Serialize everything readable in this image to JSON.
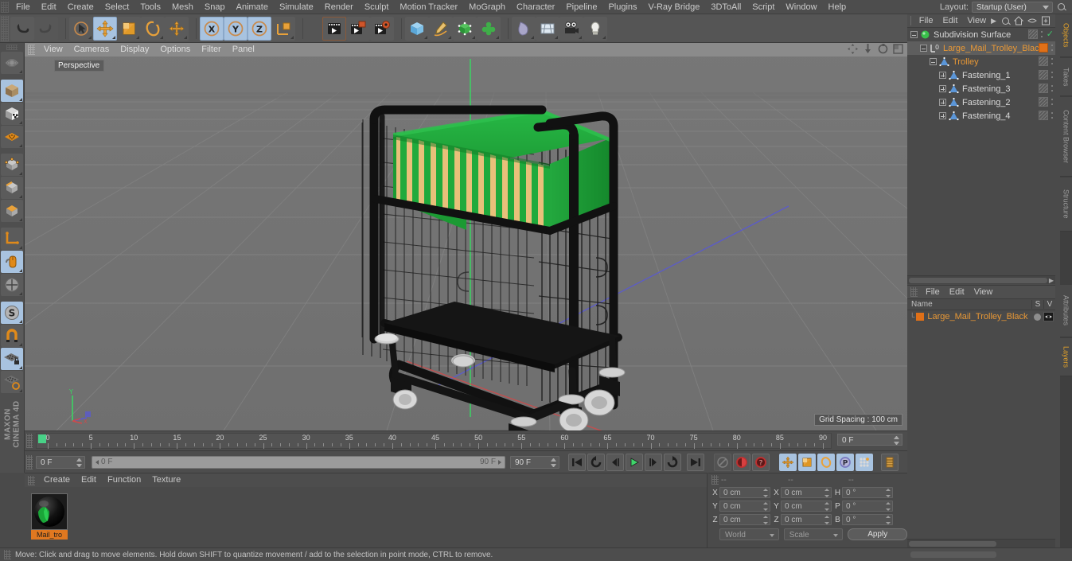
{
  "app": {
    "name": "MAXON CINEMA 4D",
    "brand_line1": "MAXON",
    "brand_line2": "CINEMA 4D"
  },
  "menubar": {
    "items": [
      {
        "label": "File"
      },
      {
        "label": "Edit"
      },
      {
        "label": "Create"
      },
      {
        "label": "Select"
      },
      {
        "label": "Tools"
      },
      {
        "label": "Mesh"
      },
      {
        "label": "Snap"
      },
      {
        "label": "Animate"
      },
      {
        "label": "Simulate"
      },
      {
        "label": "Render"
      },
      {
        "label": "Sculpt"
      },
      {
        "label": "Motion Tracker"
      },
      {
        "label": "MoGraph"
      },
      {
        "label": "Character"
      },
      {
        "label": "Pipeline"
      },
      {
        "label": "Plugins"
      },
      {
        "label": "V-Ray Bridge"
      },
      {
        "label": "3DToAll"
      },
      {
        "label": "Script"
      },
      {
        "label": "Window"
      },
      {
        "label": "Help"
      }
    ],
    "layout_label": "Layout:",
    "layout_value": "Startup (User)",
    "search_icon": "search-icon"
  },
  "toolbar": {
    "items": [
      {
        "name": "undo-button",
        "icon": "undo-arrow-icon",
        "active": false
      },
      {
        "name": "redo-button",
        "icon": "redo-arrow-icon",
        "active": false
      },
      {
        "name": "live-selection-tool",
        "icon": "cursor-circle-icon",
        "active": false
      },
      {
        "name": "move-tool",
        "icon": "move-arrows-icon",
        "active": true
      },
      {
        "name": "scale-tool",
        "icon": "scale-box-icon",
        "active": false
      },
      {
        "name": "rotate-tool",
        "icon": "rotate-ring-icon",
        "active": false
      },
      {
        "name": "axis-tool",
        "icon": "plus-axis-icon",
        "active": false
      },
      {
        "name": "x-axis-lock",
        "icon": "x-axis-icon",
        "active": true
      },
      {
        "name": "y-axis-lock",
        "icon": "y-axis-icon",
        "active": true
      },
      {
        "name": "z-axis-lock",
        "icon": "z-axis-icon",
        "active": true
      },
      {
        "name": "world-object-coordinate-toggle",
        "icon": "world-axis-cube-icon",
        "active": false
      },
      {
        "name": "render-view-button",
        "icon": "render-clapper-icon",
        "active": false
      },
      {
        "name": "render-region-button",
        "icon": "render-region-icon",
        "active": false
      },
      {
        "name": "render-settings-button",
        "icon": "render-settings-gear-icon",
        "active": false
      },
      {
        "name": "primitive-cube-menu",
        "icon": "cube-icon",
        "active": false
      },
      {
        "name": "spline-pen-menu",
        "icon": "pen-spline-icon",
        "active": false
      },
      {
        "name": "generator-menu",
        "icon": "green-cube-generator-icon",
        "active": false
      },
      {
        "name": "modeling-object-menu",
        "icon": "green-cluster-icon",
        "active": false
      },
      {
        "name": "deformer-menu",
        "icon": "bend-deformer-icon",
        "active": false
      },
      {
        "name": "scene-environment-menu",
        "icon": "floor-grid-icon",
        "active": false
      },
      {
        "name": "camera-menu",
        "icon": "camera-icon",
        "active": false
      },
      {
        "name": "light-menu",
        "icon": "light-bulb-icon",
        "active": false
      }
    ]
  },
  "left_toolbar": {
    "items": [
      {
        "name": "make-editable-button",
        "icon": "make-editable-icon",
        "active": false
      },
      {
        "name": "model-mode-button",
        "icon": "model-cube-icon",
        "active": true
      },
      {
        "name": "texture-mode-button",
        "icon": "texture-cube-icon",
        "active": false
      },
      {
        "name": "texture-axis-button",
        "icon": "texture-axis-icon",
        "active": false
      },
      {
        "name": "point-mode-button",
        "icon": "point-cube-icon",
        "active": false
      },
      {
        "name": "edge-mode-button",
        "icon": "edge-cube-icon",
        "active": false
      },
      {
        "name": "polygon-mode-button",
        "icon": "polygon-cube-icon",
        "active": false
      },
      {
        "name": "object-axis-button",
        "icon": "object-axis-icon",
        "active": false
      },
      {
        "name": "viewport-solo-button",
        "icon": "mouse-icon",
        "active": true
      },
      {
        "name": "enable-axis-button",
        "icon": "axis-modify-icon",
        "active": false
      },
      {
        "name": "soft-selection-button",
        "icon": "soft-selection-s-icon",
        "active": true
      },
      {
        "name": "snap-button",
        "icon": "magnet-icon",
        "active": false
      },
      {
        "name": "workplane-lock-button",
        "icon": "workplane-lock-icon",
        "active": true
      },
      {
        "name": "workplane-button",
        "icon": "workplane-icon",
        "active": false
      }
    ]
  },
  "viewport": {
    "menu_items": [
      {
        "label": "View"
      },
      {
        "label": "Cameras"
      },
      {
        "label": "Display"
      },
      {
        "label": "Options"
      },
      {
        "label": "Filter"
      },
      {
        "label": "Panel"
      }
    ],
    "label": "Perspective",
    "grid_spacing": "Grid Spacing : 100 cm",
    "corner_icons": [
      {
        "name": "viewport-pan-icon"
      },
      {
        "name": "viewport-dolly-icon"
      },
      {
        "name": "viewport-orbit-icon"
      },
      {
        "name": "viewport-maximize-icon"
      }
    ],
    "axis_gizmo": {
      "y_label": "Y",
      "x_label": "X",
      "z_label": "Z"
    },
    "scene": {
      "object": "Large Mail Trolley (Black)",
      "frame_color": "#1b1b1b",
      "folder_green": "#1faa3c",
      "envelope_tan": "#e8c07a",
      "wheel_color": "#cfcfcf",
      "ground_color": "#737373"
    }
  },
  "timeline": {
    "ticks": [
      {
        "label": "0",
        "value": 0
      },
      {
        "label": "5",
        "value": 5
      },
      {
        "label": "10",
        "value": 10
      },
      {
        "label": "15",
        "value": 15
      },
      {
        "label": "20",
        "value": 20
      },
      {
        "label": "25",
        "value": 25
      },
      {
        "label": "30",
        "value": 30
      },
      {
        "label": "35",
        "value": 35
      },
      {
        "label": "40",
        "value": 40
      },
      {
        "label": "45",
        "value": 45
      },
      {
        "label": "50",
        "value": 50
      },
      {
        "label": "55",
        "value": 55
      },
      {
        "label": "60",
        "value": 60
      },
      {
        "label": "65",
        "value": 65
      },
      {
        "label": "70",
        "value": 70
      },
      {
        "label": "75",
        "value": 75
      },
      {
        "label": "80",
        "value": 80
      },
      {
        "label": "85",
        "value": 85
      },
      {
        "label": "90",
        "value": 90
      }
    ],
    "current_frame_field": "0 F",
    "range_min": 0,
    "range_max": 90,
    "playhead_frame": 0
  },
  "playbar": {
    "current_frame": "0 F",
    "range_start": "0 F",
    "range_end_inline": "90 F",
    "range_end": "90 F",
    "buttons": [
      {
        "name": "go-to-start-button",
        "icon": "skip-start-icon",
        "active": false
      },
      {
        "name": "play-backwards-loop-button",
        "icon": "loop-back-icon",
        "active": false
      },
      {
        "name": "previous-frame-button",
        "icon": "step-back-icon",
        "active": false
      },
      {
        "name": "play-button",
        "icon": "play-triangle-icon",
        "active": false
      },
      {
        "name": "next-frame-button",
        "icon": "step-forward-icon",
        "active": false
      },
      {
        "name": "play-forward-loop-button",
        "icon": "loop-forward-icon",
        "active": false
      },
      {
        "name": "go-to-end-button",
        "icon": "skip-end-icon",
        "active": false
      },
      {
        "name": "record-active-objects-button",
        "icon": "record-keyframe-icon",
        "active": false
      },
      {
        "name": "autokeying-button",
        "icon": "autokey-red-icon",
        "active": false
      },
      {
        "name": "keyframe-selection-button",
        "icon": "keyframe-question-icon",
        "active": false
      },
      {
        "name": "position-key-button",
        "icon": "position-key-icon",
        "active": true
      },
      {
        "name": "scale-key-button",
        "icon": "scale-key-icon",
        "active": true
      },
      {
        "name": "rotation-key-button",
        "icon": "rotation-key-icon",
        "active": true
      },
      {
        "name": "parameter-key-button",
        "icon": "param-key-p-icon",
        "active": true
      },
      {
        "name": "pla-key-button",
        "icon": "pla-dots-icon",
        "active": true
      },
      {
        "name": "timeline-layout-button",
        "icon": "timeline-layout-icon",
        "active": false
      }
    ]
  },
  "material_manager": {
    "menu_items": [
      {
        "label": "Create"
      },
      {
        "label": "Edit"
      },
      {
        "label": "Function"
      },
      {
        "label": "Texture"
      }
    ],
    "materials": [
      {
        "name": "Mail_tro",
        "preview": "green-black-sphere"
      }
    ]
  },
  "coordinates": {
    "header_dashes": [
      "--",
      "--",
      "--"
    ],
    "position_rows": [
      {
        "axis": "X",
        "value": "0 cm"
      },
      {
        "axis": "Y",
        "value": "0 cm"
      },
      {
        "axis": "Z",
        "value": "0 cm"
      }
    ],
    "size_rows": [
      {
        "axis": "X",
        "value": "0 cm"
      },
      {
        "axis": "Y",
        "value": "0 cm"
      },
      {
        "axis": "Z",
        "value": "0 cm"
      }
    ],
    "rotation_rows": [
      {
        "axis": "H",
        "value": "0 °"
      },
      {
        "axis": "P",
        "value": "0 °"
      },
      {
        "axis": "B",
        "value": "0 °"
      }
    ],
    "coord_system": "World",
    "size_mode": "Scale",
    "apply_label": "Apply"
  },
  "object_manager": {
    "menu_items": [
      {
        "label": "File"
      },
      {
        "label": "Edit"
      },
      {
        "label": "View"
      }
    ],
    "header_icons": [
      {
        "name": "more-arrow-icon"
      },
      {
        "name": "search-icon"
      },
      {
        "name": "home-icon"
      },
      {
        "name": "eye-icon"
      },
      {
        "name": "fit-icon"
      }
    ],
    "tree": [
      {
        "label": "Subdivision Surface",
        "depth": 0,
        "icon": "subdivision-surface-icon",
        "icon_color": "#39c04a",
        "tag": "checker",
        "check": true,
        "selected": false,
        "expander": "minus"
      },
      {
        "label": "Large_Mail_Trolley_Black",
        "depth": 1,
        "icon": "null-object-icon",
        "icon_color": "#b8b8b8",
        "tag": "orange",
        "check": false,
        "selected": true,
        "expander": "minus"
      },
      {
        "label": "Trolley",
        "depth": 2,
        "icon": "polygon-object-icon",
        "icon_color": "#5b96d8",
        "tag": "checker",
        "check": false,
        "selected": false,
        "expander": "minus"
      },
      {
        "label": "Fastening_1",
        "depth": 3,
        "icon": "polygon-object-icon",
        "icon_color": "#5b96d8",
        "tag": "checker",
        "check": false,
        "selected": false,
        "expander": "plus"
      },
      {
        "label": "Fastening_3",
        "depth": 3,
        "icon": "polygon-object-icon",
        "icon_color": "#5b96d8",
        "tag": "checker",
        "check": false,
        "selected": false,
        "expander": "plus"
      },
      {
        "label": "Fastening_2",
        "depth": 3,
        "icon": "polygon-object-icon",
        "icon_color": "#5b96d8",
        "tag": "checker",
        "check": false,
        "selected": false,
        "expander": "plus"
      },
      {
        "label": "Fastening_4",
        "depth": 3,
        "icon": "polygon-object-icon",
        "icon_color": "#5b96d8",
        "tag": "checker",
        "check": false,
        "selected": false,
        "expander": "plus"
      }
    ]
  },
  "attributes_panel": {
    "menu_items": [
      {
        "label": "File"
      },
      {
        "label": "Edit"
      },
      {
        "label": "View"
      }
    ],
    "columns": {
      "name": "Name",
      "s": "S",
      "v": "V"
    },
    "rows": [
      {
        "name": "Large_Mail_Trolley_Black",
        "color": "#e07018"
      }
    ]
  },
  "vertical_tabs": [
    {
      "label": "Objects",
      "active": true
    },
    {
      "label": "Takes",
      "active": false
    },
    {
      "label": "Content Browser",
      "active": false
    },
    {
      "label": "Structure",
      "active": false
    },
    {
      "label": "Attributes",
      "active": false
    },
    {
      "label": "Layers",
      "active": true
    }
  ],
  "statusbar": {
    "message": "Move: Click and drag to move elements. Hold down SHIFT to quantize movement / add to the selection in point mode, CTRL to remove."
  }
}
